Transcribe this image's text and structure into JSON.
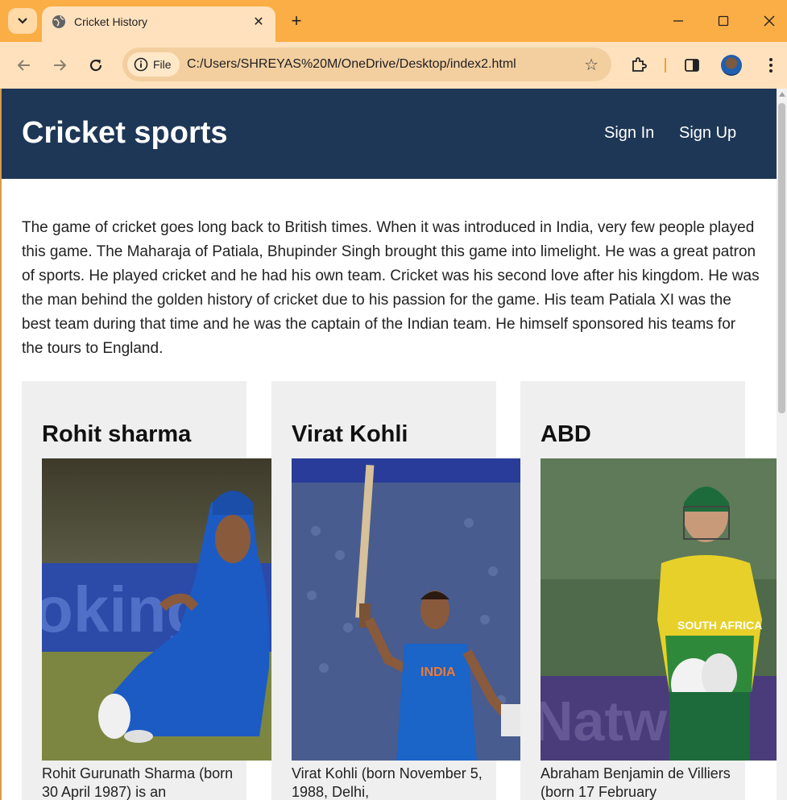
{
  "browser": {
    "tab_title": "Cricket History",
    "chip_label": "File",
    "url": "C:/Users/SHREYAS%20M/OneDrive/Desktop/index2.html"
  },
  "site": {
    "brand": "Cricket sports",
    "nav": {
      "sign_in": "Sign In",
      "sign_up": "Sign Up"
    },
    "intro": "The game of cricket goes long back to British times. When it was introduced in India, very few people played this game. The Maharaja of Patiala, Bhupinder Singh brought this game into limelight. He was a great patron of sports. He played cricket and he had his own team. Cricket was his second love after his kingdom. He was the man behind the golden history of cricket due to his passion for the game. His team Patiala XI was the best team during that time and he was the captain of the Indian team. He himself sponsored his teams for the tours to England.",
    "cards": [
      {
        "title": "Rohit sharma",
        "desc": "Rohit Gurunath Sharma (born 30 April 1987) is an"
      },
      {
        "title": "Virat Kohli",
        "desc": "Virat Kohli (born November 5, 1988, Delhi,"
      },
      {
        "title": "ABD",
        "desc": "Abraham Benjamin de Villiers (born 17 February"
      }
    ]
  },
  "colors": {
    "header_bg": "#1e3756",
    "card_bg": "#efefef",
    "tabstrip_bg": "#fbae45",
    "toolbar_bg": "#ffe2bd"
  }
}
